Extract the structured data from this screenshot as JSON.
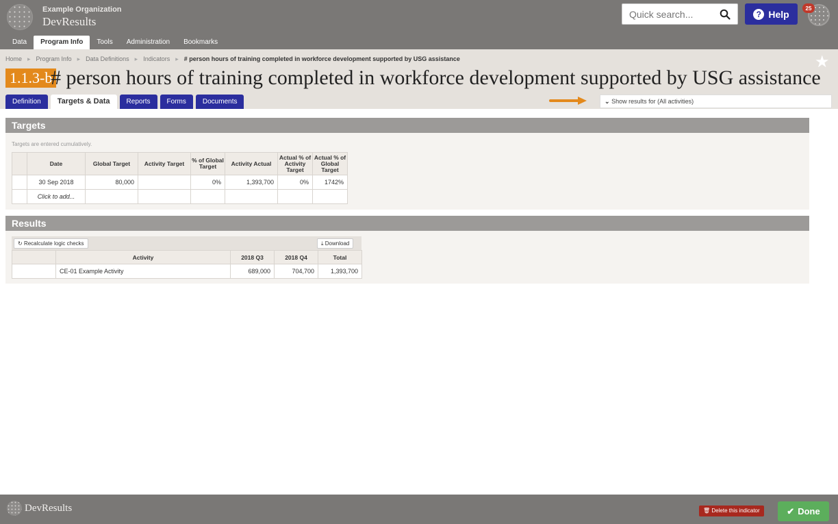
{
  "org": {
    "name": "Example Organization",
    "app": "DevResults"
  },
  "search": {
    "placeholder": "Quick search..."
  },
  "help": {
    "label": "Help"
  },
  "user": {
    "notifications": "25"
  },
  "mainnav": [
    "Data",
    "Program Info",
    "Tools",
    "Administration",
    "Bookmarks"
  ],
  "breadcrumb": [
    "Home",
    "Program Info",
    "Data Definitions",
    "Indicators",
    "# person hours of training completed in workforce development supported by USG assistance"
  ],
  "indicator": {
    "code": "1.1.3-b",
    "title": "# person hours of training completed in workforce development supported by USG assistance"
  },
  "subtabs": [
    "Definition",
    "Targets & Data",
    "Reports",
    "Forms",
    "Documents"
  ],
  "filter": {
    "label": "Show results for (All activities)"
  },
  "targets": {
    "heading": "Targets",
    "note": "Targets are entered cumulatively.",
    "columns": [
      "Date",
      "Global Target",
      "Activity Target",
      "% of Global Target",
      "Activity Actual",
      "Actual % of Activity Target",
      "Actual % of Global Target"
    ],
    "rows": [
      [
        "30 Sep 2018",
        "80,000",
        "",
        "0%",
        "1,393,700",
        "0%",
        "1742%"
      ]
    ],
    "add_hint": "Click to add..."
  },
  "results": {
    "heading": "Results",
    "recalc_label": "Recalculate logic checks",
    "download_label": "Download",
    "columns": [
      "Activity",
      "2018 Q3",
      "2018 Q4",
      "Total"
    ],
    "rows": [
      [
        "CE-01 Example Activity",
        "689,000",
        "704,700",
        "1,393,700"
      ]
    ]
  },
  "footer": {
    "app": "DevResults",
    "delete_label": "Delete this indicator",
    "done_label": "Done"
  },
  "colors": {
    "accent": "#2b2e9e",
    "badge": "#e3891c",
    "done": "#5cae5c",
    "danger": "#a8281e"
  }
}
